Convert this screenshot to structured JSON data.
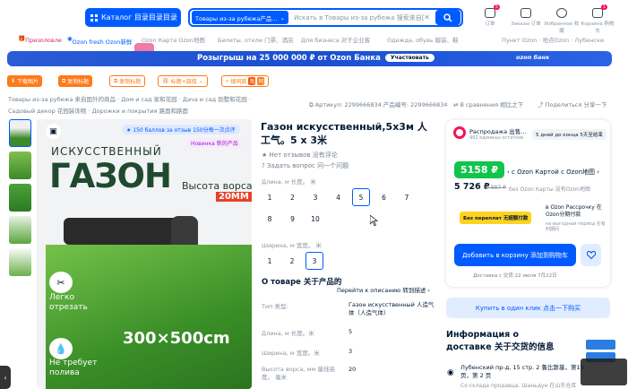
{
  "header": {
    "catalog_label": "Каталог 目录目录目录",
    "search_scope": "Товары из-за рубежа产品...",
    "search_placeholder": "Искать в Товары из-за рубежа 搜索来自国外的商品",
    "topics": [
      {
        "label": "订单",
        "badge": "5"
      },
      {
        "label": "Заказы 订单",
        "badge": ""
      },
      {
        "label": "Избранное 收藏",
        "badge": ""
      },
      {
        "label": "Корзина 购物车",
        "badge": "1"
      }
    ]
  },
  "nav": {
    "items": [
      "Призоловле",
      "Ozon fresh Ozon新鲜",
      "Ozon Карта Ozon地图",
      "Билеты, отели 门票、酒店",
      "Для бизнеса 对于企业客",
      "Одежда, обувь 服装、鞋"
    ],
    "location": "Пункт Ozon · 地点Ozon · Лубенски"
  },
  "banner": {
    "text": "Розыгрыш на 25 000 000 ₽ от Ozon Банка",
    "button": "Участвовать",
    "brand": "ozon банк"
  },
  "toolbar": [
    "下载图片",
    "复制标题",
    "复制标题",
    "标题+链接",
    "搜同款"
  ],
  "breadcrumbs": {
    "line1": [
      "Товары из-за рубежа 来自国外的商品",
      "Дом и сад 家和花园",
      "Дача и сад 别墅和花园"
    ],
    "line2": [
      "Садовый декор 花园装饰物",
      "Дорожки и покрытия 路面和路面"
    ],
    "article": "Артикул: 2299666834 产品编号: 2299666834",
    "compare": "В сравнения 相比之下",
    "share": "Поделиться 分享一下"
  },
  "gallery": {
    "bonus": "150 баллов за отзыв 150分每一次点评",
    "badge": "Новинка 新的产品",
    "big1": "ИСКУССТВЕННЫЙ",
    "big2": "ГАЗОН",
    "height_label": "Высота ворса",
    "height_value": "20ММ",
    "size_text": "300×500cm",
    "feat1": "Легко отрезать",
    "feat2": "Не требует полива"
  },
  "product": {
    "title": "Газон искусственный,5х3м 人工气。5 x 3米",
    "reviews": "Нет отзывов 没有评论",
    "ask": "Задать вопрос 问一个问题",
    "length_label": "Длина, м 长度。 米",
    "lengths": [
      "1",
      "2",
      "3",
      "4",
      "5",
      "6",
      "7",
      "8",
      "9",
      "10"
    ],
    "length_selected": "5",
    "width_label": "Ширина, м 宽度。 米",
    "widths": [
      "1",
      "2",
      "3"
    ],
    "width_selected": "3",
    "about_title": "О товаре 关于产品的",
    "about_link": "Перейти к описанию 转到描述",
    "props": [
      {
        "k": "Тип 类型:",
        "v": "Газон искусственный 人造气体（人造气体）"
      },
      {
        "k": "Длина, м 长度。米",
        "v": "5"
      },
      {
        "k": "Ширина, м 宽度。米",
        "v": "3"
      },
      {
        "k": "Высота ворса, мм 量线高度。 毫米",
        "v": "20"
      }
    ]
  },
  "buybox": {
    "sale_title": "Распродажа 出售...",
    "sale_sub": "992 единицы остатков",
    "countdown": "5 дней до конца 5天至结束",
    "price_card": "5158 ₽",
    "price_card_note": "с Ozon Картой с Ozon地图",
    "price_regular": "5 726 ₽",
    "price_old": "9 887 ₽",
    "price_regular_note": "без Ozon Карты 没有Ozon地图",
    "overpay_badge": "Без переплат 无超额付款",
    "installment": "в Ozon Рассрочку 在Ozon分期付款",
    "installment_sub": "на выгодный период 在有利期间",
    "cart_button": "Добавить в корзину 添加到购物车",
    "delivery": "Доставка с 交货:22 июля 7月22日",
    "one_click": "Купить в один клик 点击一下购买"
  },
  "delivery_info": {
    "title": "Информация о доставке 关于交货的信息",
    "address": "Лубенский пр-д, 15 стр. 2 鲁比斯基，第15页，第 2 页",
    "warehouse": "Со склада продавца. Шаньдун 在山东仓库"
  },
  "colors": {
    "accent": "#005bff",
    "green": "#10c44c",
    "pink": "#f91155",
    "text": "#001a34"
  }
}
